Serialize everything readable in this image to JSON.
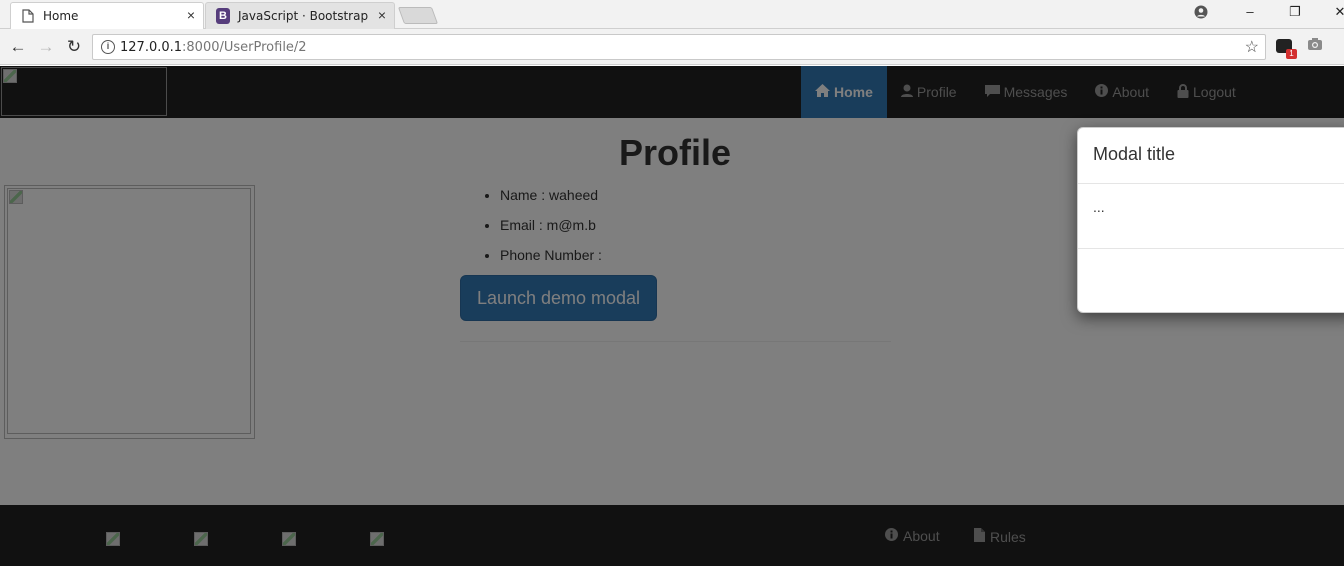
{
  "browser": {
    "tabs": [
      {
        "title": "Home",
        "close": "×"
      },
      {
        "title": "JavaScript · Bootstrap",
        "close": "×",
        "favicon": "B"
      }
    ],
    "window": {
      "profile": "●",
      "minimize": "–",
      "restore": "❐",
      "close": "✕"
    },
    "nav": {
      "back": "←",
      "forward": "→",
      "reload": "↻"
    },
    "url_host": "127.0.0.1",
    "url_rest": ":8000/UserProfile/2",
    "star": "☆",
    "extension_badge": "1",
    "camera": "📷"
  },
  "navbar": {
    "items": [
      {
        "label": "Home",
        "icon": "home-icon",
        "glyph": "⌂",
        "active": true
      },
      {
        "label": "Profile",
        "icon": "user-icon",
        "glyph": "👤"
      },
      {
        "label": "Messages",
        "icon": "comment-icon",
        "glyph": "▬"
      },
      {
        "label": "About",
        "icon": "info-icon",
        "glyph": "ℹ"
      },
      {
        "label": "Logout",
        "icon": "lock-icon",
        "glyph": "🔒"
      }
    ]
  },
  "main": {
    "title": "Profile",
    "info": [
      "Name : waheed",
      "Email : m@m.b",
      "Phone Number :"
    ],
    "launch_button": "Launch demo modal"
  },
  "footer": {
    "links": [
      {
        "label": "About",
        "icon": "info-icon",
        "glyph": "ℹ"
      },
      {
        "label": "Rules",
        "icon": "file-icon",
        "glyph": "▤"
      }
    ]
  },
  "modal": {
    "title": "Modal title",
    "body": "..."
  },
  "colors": {
    "navbar_bg": "#222222",
    "active_nav": "#337ab7",
    "primary_button": "#337ab7",
    "backdrop": "rgba(0,0,0,0.5)"
  }
}
